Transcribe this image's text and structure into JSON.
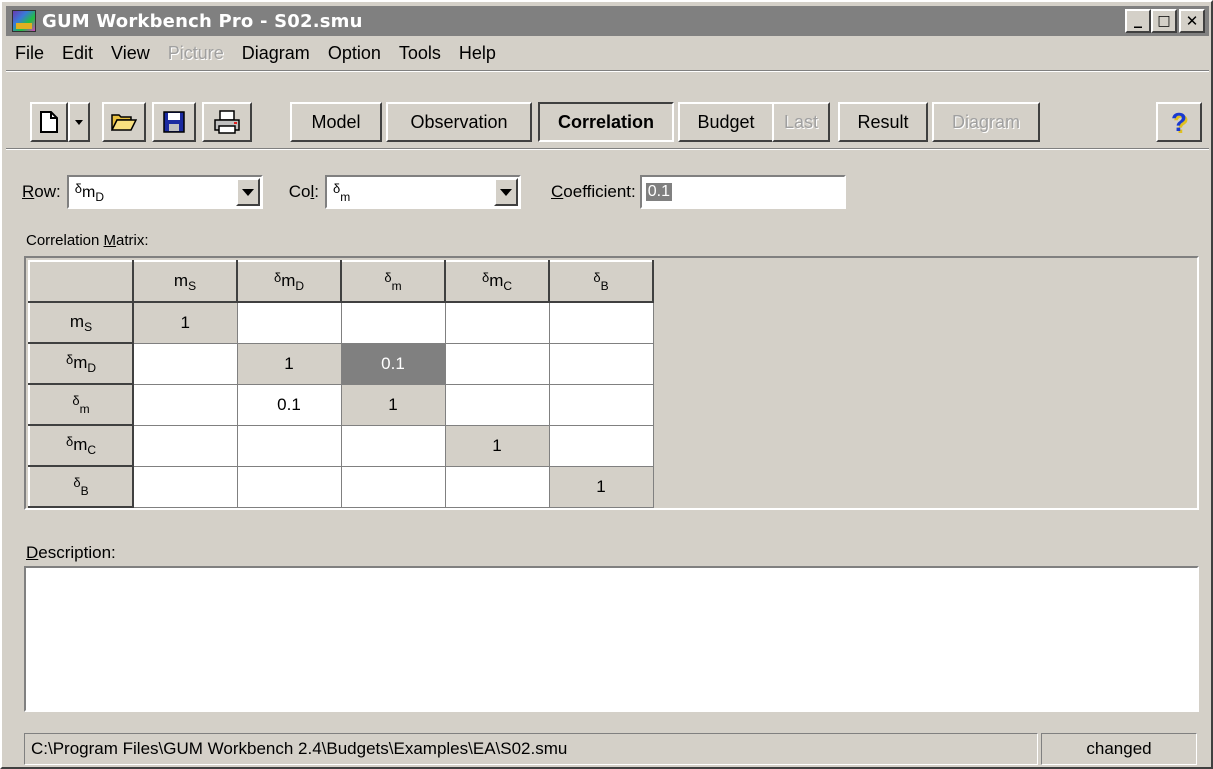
{
  "window": {
    "title": "GUM Workbench Pro - S02.smu",
    "minimize": "_",
    "maximize": "□",
    "close": "✕"
  },
  "menu": [
    {
      "label": "File",
      "enabled": true
    },
    {
      "label": "Edit",
      "enabled": true
    },
    {
      "label": "View",
      "enabled": true
    },
    {
      "label": "Picture",
      "enabled": false
    },
    {
      "label": "Diagram",
      "enabled": true
    },
    {
      "label": "Option",
      "enabled": true
    },
    {
      "label": "Tools",
      "enabled": true
    },
    {
      "label": "Help",
      "enabled": true
    }
  ],
  "toolbar": {
    "model": "Model",
    "observation": "Observation",
    "correlation": "Correlation",
    "budget": "Budget",
    "last": "Last",
    "result": "Result",
    "diagram": "Diagram",
    "help": "?"
  },
  "selectors": {
    "row_label_u": "R",
    "row_label_rest": "ow:",
    "row_value": {
      "pre": "δ",
      "main": "m",
      "sub": "D"
    },
    "col_label_pre": "Co",
    "col_label_u": "l",
    "col_label_post": ":",
    "col_value": {
      "pre": "δ",
      "main": "",
      "sub": "m"
    },
    "coef_label_u": "C",
    "coef_label_rest": "oefficient:",
    "coef_value": "0.1"
  },
  "matrix": {
    "label_pre": "Correlation ",
    "label_u": "M",
    "label_post": "atrix:",
    "headers": [
      {
        "pre": "",
        "main": "m",
        "sub": "S"
      },
      {
        "pre": "δ",
        "main": "m",
        "sub": "D"
      },
      {
        "pre": "δ",
        "main": "",
        "sub": "m"
      },
      {
        "pre": "δ",
        "main": "m",
        "sub": "C"
      },
      {
        "pre": "δ",
        "main": "",
        "sub": "B"
      }
    ],
    "rows": [
      [
        "1",
        "",
        "",
        "",
        ""
      ],
      [
        "",
        "1",
        "0.1",
        "",
        ""
      ],
      [
        "",
        "0.1",
        "1",
        "",
        ""
      ],
      [
        "",
        "",
        "",
        "1",
        ""
      ],
      [
        "",
        "",
        "",
        "",
        "1"
      ]
    ],
    "selected_cell": [
      1,
      2
    ]
  },
  "description": {
    "label_u": "D",
    "label_rest": "escription:",
    "text": ""
  },
  "status": {
    "path": "C:\\Program Files\\GUM Workbench 2.4\\Budgets\\Examples\\EA\\S02.smu",
    "state": "changed"
  }
}
